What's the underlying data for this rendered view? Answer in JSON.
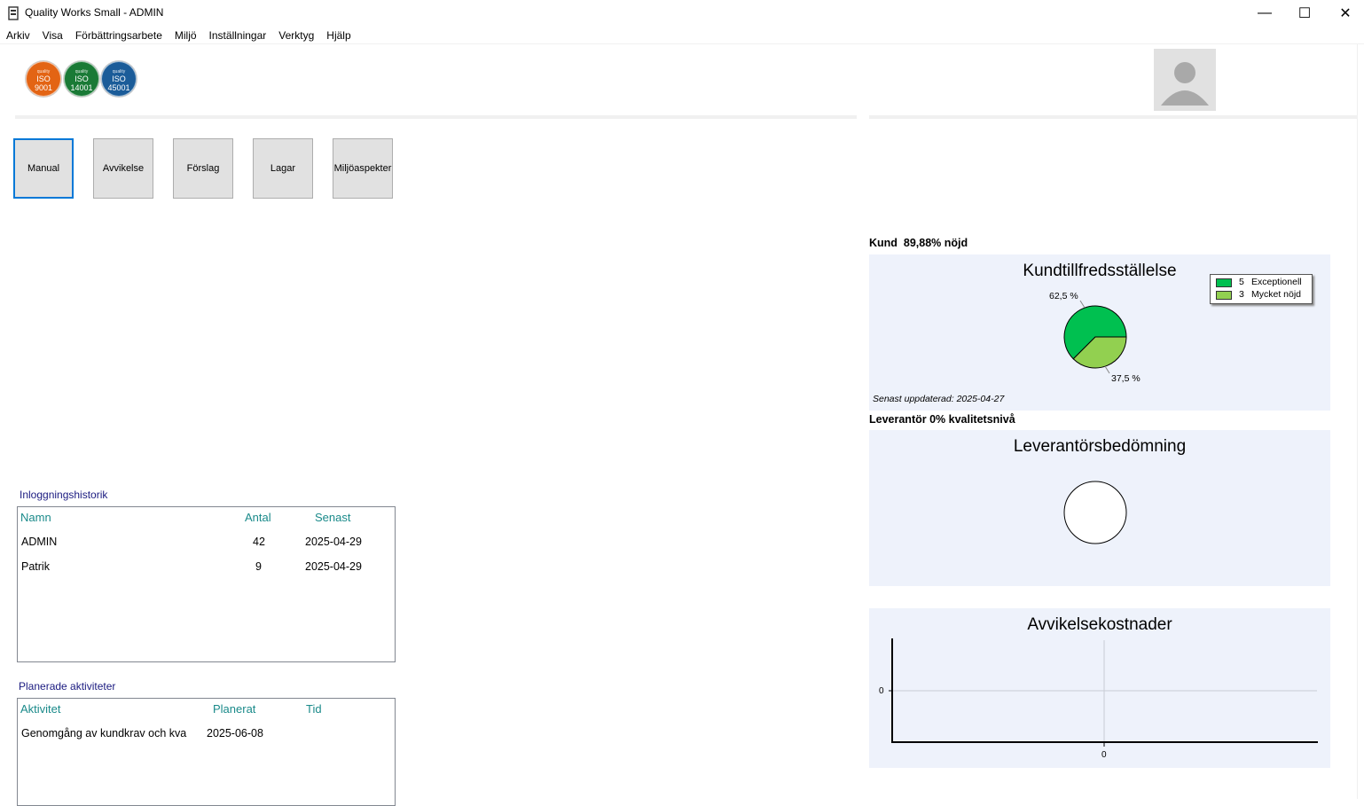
{
  "window": {
    "title": "Quality Works Small - ADMIN",
    "minimize": "—",
    "maximize": "☐",
    "close": "✕"
  },
  "menu": [
    "Arkiv",
    "Visa",
    "Förbättringsarbete",
    "Miljö",
    "Inställningar",
    "Verktyg",
    "Hjälp"
  ],
  "iso_logos": [
    {
      "quality": "quality",
      "iso": "ISO",
      "number": "9001",
      "color": "#e36414"
    },
    {
      "quality": "quality",
      "iso": "ISO",
      "number": "14001",
      "color": "#1a7a36"
    },
    {
      "quality": "quality",
      "iso": "ISO",
      "number": "45001",
      "color": "#1b5c99"
    }
  ],
  "buttons": [
    "Manual",
    "Avvikelse",
    "Förslag",
    "Lagar",
    "Miljöaspekter"
  ],
  "login_history": {
    "label": "Inloggningshistorik",
    "columns": [
      "Namn",
      "Antal",
      "Senast"
    ],
    "rows": [
      {
        "name": "ADMIN",
        "count": "42",
        "last": "2025-04-29"
      },
      {
        "name": "Patrik",
        "count": "9",
        "last": "2025-04-29"
      }
    ]
  },
  "planned": {
    "label": "Planerade aktiviteter",
    "columns": [
      "Aktivitet",
      "Planerat",
      "Tid"
    ],
    "rows": [
      {
        "activity": "Genomgång av kundkrav och kva",
        "planned": "2025-06-08",
        "time": ""
      }
    ]
  },
  "customer": {
    "label": "Kund  89,88% nöjd",
    "updated": "Senast uppdaterad: 2025-04-27"
  },
  "supplier": {
    "label": "Leverantör 0% kvalitetsnivå"
  },
  "chart_data": [
    {
      "type": "pie",
      "title": "Kundtillfredsställelse",
      "slices": [
        {
          "name": "Exceptionell",
          "count": "5",
          "value": 62.5,
          "label": "62,5 %",
          "color": "#00c050"
        },
        {
          "name": "Mycket nöjd",
          "count": "3",
          "value": 37.5,
          "label": "37,5 %",
          "color": "#92d050"
        }
      ],
      "legend": "top-right"
    },
    {
      "type": "pie",
      "title": "Leverantörsbedömning",
      "slices": []
    },
    {
      "type": "line",
      "title": "Avvikelsekostnader",
      "x": [],
      "series": [],
      "xticks": [
        "0"
      ],
      "yticks": [
        "0"
      ],
      "grid": true
    }
  ]
}
